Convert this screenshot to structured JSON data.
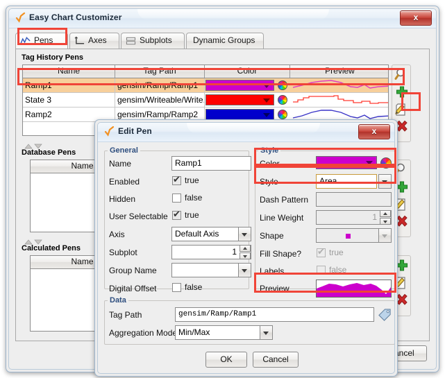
{
  "main_window": {
    "title": "Easy Chart Customizer",
    "icon": "orange-check-icon",
    "close_label": "x",
    "tabs": [
      {
        "label": "Pens",
        "icon": "line-chart-icon",
        "active": true
      },
      {
        "label": "Axes",
        "icon": "axes-icon",
        "active": false
      },
      {
        "label": "Subplots",
        "icon": "subplots-icon",
        "active": false
      },
      {
        "label": "Dynamic Groups",
        "icon": "none",
        "active": false
      }
    ],
    "sections": [
      {
        "id": "tag-history-pens",
        "title": "Tag History Pens",
        "columns": [
          "Name",
          "Tag Path",
          "Color",
          "Preview"
        ],
        "rows": [
          {
            "name": "Ramp1",
            "tag_path": "gensim/Ramp/Ramp1",
            "color": "#CC00CC",
            "selected": true
          },
          {
            "name": "State 3",
            "tag_path": "gensim/Writeable/Write...",
            "color": "#FF0000",
            "selected": false
          },
          {
            "name": "Ramp2",
            "tag_path": "gensim/Ramp/Ramp2",
            "color": "#0000CC",
            "selected": false
          }
        ],
        "toolbar": [
          "search-icon",
          "add-icon",
          "edit-icon",
          "delete-icon"
        ]
      },
      {
        "id": "database-pens",
        "title": "Database Pens",
        "columns": [
          "Name"
        ],
        "rows": [],
        "toolbar": [
          "search-icon",
          "add-icon",
          "edit-icon",
          "delete-icon"
        ]
      },
      {
        "id": "calculated-pens",
        "title": "Calculated Pens",
        "columns": [
          "Name"
        ],
        "rows": [],
        "toolbar": [
          "add-icon",
          "edit-icon",
          "delete-icon"
        ]
      }
    ],
    "footer": {
      "cancel_label": "Cancel"
    }
  },
  "edit_pen_dialog": {
    "title": "Edit Pen",
    "icon": "orange-check-icon",
    "close_label": "x",
    "general": {
      "legend": "General",
      "name_label": "Name",
      "name_value": "Ramp1",
      "enabled_label": "Enabled",
      "enabled_value": "true",
      "enabled_checked": true,
      "hidden_label": "Hidden",
      "hidden_value": "false",
      "hidden_checked": false,
      "user_selectable_label": "User Selectable",
      "user_selectable_value": "true",
      "user_selectable_checked": true,
      "axis_label": "Axis",
      "axis_value": "Default Axis",
      "subplot_label": "Subplot",
      "subplot_value": "1",
      "group_name_label": "Group Name",
      "group_name_value": "",
      "digital_offset_label": "Digital Offset",
      "digital_offset_value": "false",
      "digital_offset_checked": false
    },
    "style": {
      "legend": "Style",
      "color_label": "Color",
      "color_value": "#CC00CC",
      "style_label": "Style",
      "style_value": "Area",
      "dash_pattern_label": "Dash Pattern",
      "dash_pattern_value": "",
      "line_weight_label": "Line Weight",
      "line_weight_value": "1",
      "shape_label": "Shape",
      "shape_value": "square-marker",
      "fill_shape_label": "Fill Shape?",
      "fill_shape_value": "true",
      "fill_shape_checked": true,
      "labels_label": "Labels",
      "labels_value": "false",
      "labels_checked": false,
      "preview_label": "Preview"
    },
    "data": {
      "legend": "Data",
      "tag_path_label": "Tag Path",
      "tag_path_value": "gensim/Ramp/Ramp1",
      "tag_browse_icon": "tag-icon",
      "aggregation_label": "Aggregation Mode",
      "aggregation_value": "Min/Max"
    },
    "buttons": {
      "ok_label": "OK",
      "cancel_label": "Cancel"
    }
  }
}
